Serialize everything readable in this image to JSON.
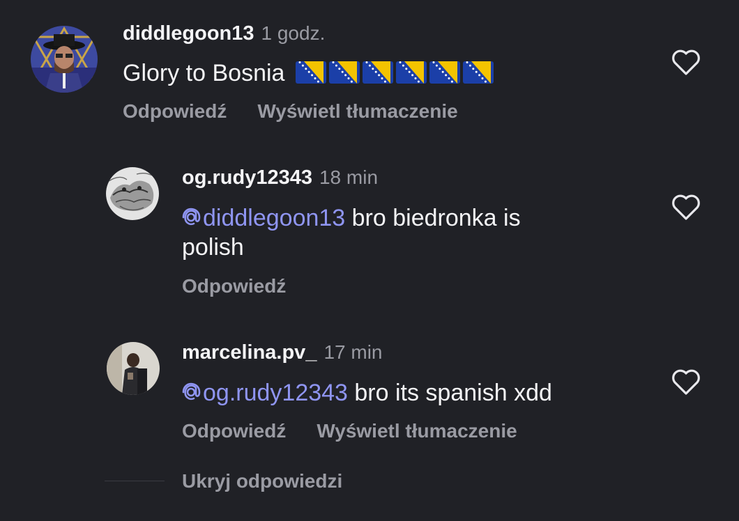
{
  "comments": [
    {
      "username": "diddlegoon13",
      "time": "1 godz.",
      "text": "Glory to Bosnia",
      "flag_count": 6,
      "actions": [
        "Odpowiedź",
        "Wyświetl tłumaczenie"
      ]
    },
    {
      "username": "og.rudy12343",
      "time": "18 min",
      "mention": "diddlegoon13",
      "text_line1": " bro biedronka is",
      "text_line2": "polish",
      "actions": [
        "Odpowiedź"
      ]
    },
    {
      "username": "marcelina.pv_",
      "time": "17 min",
      "mention": "og.rudy12343",
      "text": " bro its spanish xdd",
      "actions": [
        "Odpowiedź",
        "Wyświetl tłumaczenie"
      ]
    }
  ],
  "hide_replies_label": "Ukryj odpowiedzi",
  "colors": {
    "background": "#202126",
    "mention": "#8f95f2",
    "muted": "#9a9ba3",
    "flag_blue": "#1b3fa8",
    "flag_yellow": "#f4c300"
  },
  "icons": [
    "avatar",
    "heart-icon",
    "threads-at-icon",
    "bosnia-flag-icon"
  ]
}
